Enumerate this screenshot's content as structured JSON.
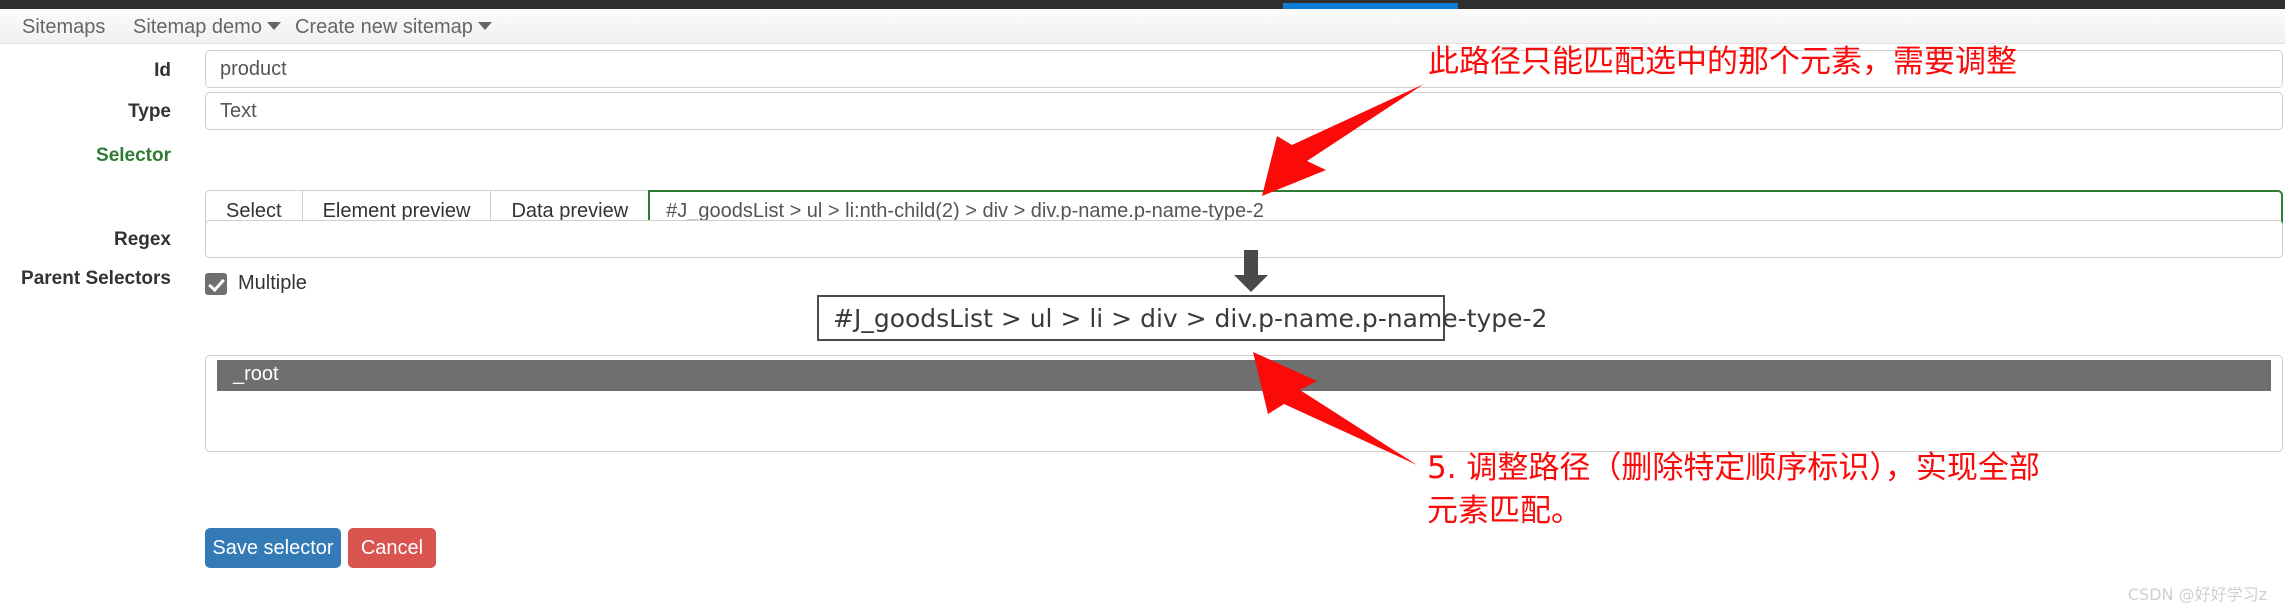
{
  "topbar": {
    "active_marker_color": "#0c7cd5",
    "background_color": "#2f2f2f"
  },
  "navbar": {
    "items": [
      {
        "label": "Sitemaps",
        "has_caret": false
      },
      {
        "label": "Sitemap demo",
        "has_caret": true
      },
      {
        "label": "Create new sitemap",
        "has_caret": true
      }
    ]
  },
  "form": {
    "id": {
      "label": "Id",
      "value": "product",
      "placeholder": ""
    },
    "type": {
      "label": "Type",
      "value": "Text",
      "placeholder": ""
    },
    "selector": {
      "label": "Selector",
      "buttons": [
        "Select",
        "Element preview",
        "Data preview"
      ],
      "value": "#J_goodsList > ul > li:nth-child(2) > div > div.p-name.p-name-type-2",
      "highlight_color": "#2e7d32"
    },
    "multiple": {
      "label": "Multiple",
      "checked": true
    },
    "regex": {
      "label": "Regex",
      "value": "",
      "placeholder": ""
    },
    "parent_selectors": {
      "label": "Parent Selectors",
      "options": [
        "_root"
      ],
      "selected": "_root"
    },
    "actions": {
      "save_label": "Save selector",
      "save_color": "#337ab7",
      "cancel_label": "Cancel",
      "cancel_color": "#d9534f"
    }
  },
  "annotations": {
    "color": "#fb0a0a",
    "top_note": "此路径只能匹配选中的那个元素，需要调整",
    "bottom_note": "5. 调整路径（删除特定顺序标识），实现全部\n元素匹配。",
    "callout_value": "#J_goodsList > ul > li > div > div.p-name.p-name-type-2"
  },
  "watermark": {
    "text": "CSDN @好好学习z"
  }
}
